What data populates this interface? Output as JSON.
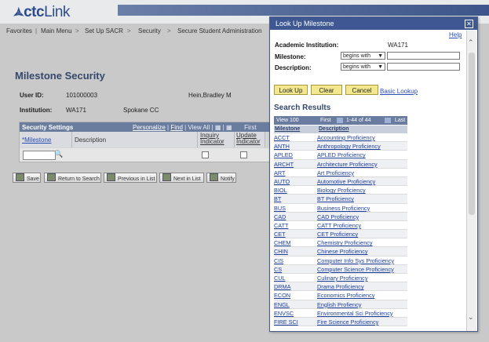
{
  "banner": {
    "logo_bold": "ctc",
    "logo_light": "Link"
  },
  "nav": {
    "items": [
      "Favorites",
      "Main Menu",
      "Set Up SACR",
      "Security",
      "Secure Student Administration"
    ],
    "separator": ">"
  },
  "page": {
    "title": "Milestone Security",
    "user_id_label": "User ID:",
    "user_id_value": "101000003",
    "user_name": "Hein,Bradley M",
    "institution_label": "Institution:",
    "institution_value": "WA171",
    "institution_name": "Spokane CC"
  },
  "grid": {
    "title": "Security Settings",
    "personalize": "Personalize",
    "find": "Find",
    "view_all": "View All",
    "first": "First",
    "col_milestone": "*Milestone",
    "col_description": "Description",
    "col_inquiry": "Inquiry Indicator",
    "col_update": "Update Indicator"
  },
  "buttons": {
    "save": "Save",
    "return_to_search": "Return to Search",
    "previous_in_list": "Previous in List",
    "next_in_list": "Next in List",
    "notify": "Notify"
  },
  "modal": {
    "title": "Look Up Milestone",
    "help": "Help",
    "academic_institution_label": "Academic Institution:",
    "academic_institution_value": "WA171",
    "milestone_label": "Milestone:",
    "milestone_operator": "begins with",
    "description_label": "Description:",
    "description_operator": "begins with",
    "lookup_button": "Look Up",
    "clear_button": "Clear",
    "cancel_button": "Cancel",
    "basic_lookup": "Basic Lookup",
    "results_title": "Search Results",
    "view_100": "View 100",
    "first": "First",
    "range": "1-44 of 44",
    "last": "Last",
    "col_milestone": "Milestone",
    "col_description": "Description",
    "results": [
      [
        "ACCT",
        "Accounting Proficiency"
      ],
      [
        "ANTH",
        "Anthropology Proficiency"
      ],
      [
        "APLED",
        "APLED Proficiency"
      ],
      [
        "ARCHT",
        "Architecture Proficiency"
      ],
      [
        "ART",
        "Art Proficiency"
      ],
      [
        "AUTO",
        "Automotive Proficiency"
      ],
      [
        "BIOL",
        "Biology Proficiency"
      ],
      [
        "BT",
        "BT Proficiency"
      ],
      [
        "BUS",
        "Business Proficiency"
      ],
      [
        "CAD",
        "CAD Proficiency"
      ],
      [
        "CATT",
        "CATT Proficiency"
      ],
      [
        "CET",
        "CET Proficiency"
      ],
      [
        "CHEM",
        "Chemistry Proficiency"
      ],
      [
        "CHIN",
        "Chinese Proficiency"
      ],
      [
        "CIS",
        "Computer Info Sys Proficiency"
      ],
      [
        "CS",
        "Computer Science Proficiency"
      ],
      [
        "CUL",
        "Culinary Proficiency"
      ],
      [
        "DRMA",
        "Drama Proficiency"
      ],
      [
        "ECON",
        "Economics Proficiency"
      ],
      [
        "ENGL",
        "English Profiency"
      ],
      [
        "ENVSC",
        "Environmental Sci Proficiency"
      ],
      [
        "FIRE SCI",
        "Fire Science Proficiency"
      ]
    ]
  }
}
